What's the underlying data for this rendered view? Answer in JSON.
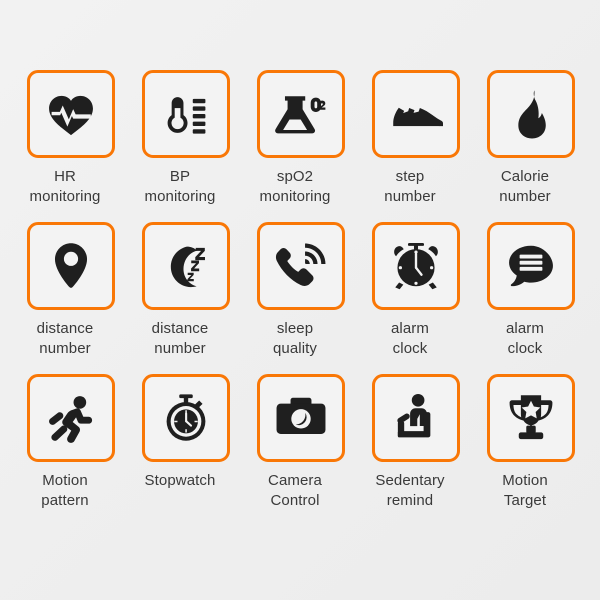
{
  "theme": {
    "accent_color": "#f97706",
    "tile_background": "#f3f3f3",
    "page_background": "#efefef",
    "icon_color": "#1f1f1f",
    "label_color": "#3a3a3a"
  },
  "grid": {
    "columns": 5,
    "rows": 3,
    "items": [
      {
        "icon": "heartbeat-icon",
        "label": "HR\nmonitoring"
      },
      {
        "icon": "thermometer-icon",
        "label": "BP\nmonitoring"
      },
      {
        "icon": "flask-o2-icon",
        "label": "spO2\nmonitoring"
      },
      {
        "icon": "sneaker-icon",
        "label": "step\nnumber"
      },
      {
        "icon": "flame-icon",
        "label": "Calorie\nnumber"
      },
      {
        "icon": "map-pin-icon",
        "label": "distance\nnumber"
      },
      {
        "icon": "moon-zzz-icon",
        "label": "distance\nnumber"
      },
      {
        "icon": "phone-ringing-icon",
        "label": "sleep\nquality"
      },
      {
        "icon": "alarm-clock-icon",
        "label": "alarm\nclock"
      },
      {
        "icon": "message-bubble-icon",
        "label": "alarm\nclock"
      },
      {
        "icon": "running-man-icon",
        "label": "Motion\npattern"
      },
      {
        "icon": "stopwatch-icon",
        "label": "Stopwatch"
      },
      {
        "icon": "camera-icon",
        "label": "Camera\nControl"
      },
      {
        "icon": "sitting-person-icon",
        "label": "Sedentary\nremind"
      },
      {
        "icon": "trophy-star-icon",
        "label": "Motion\nTarget"
      }
    ]
  },
  "flask_icon_text": "O2"
}
